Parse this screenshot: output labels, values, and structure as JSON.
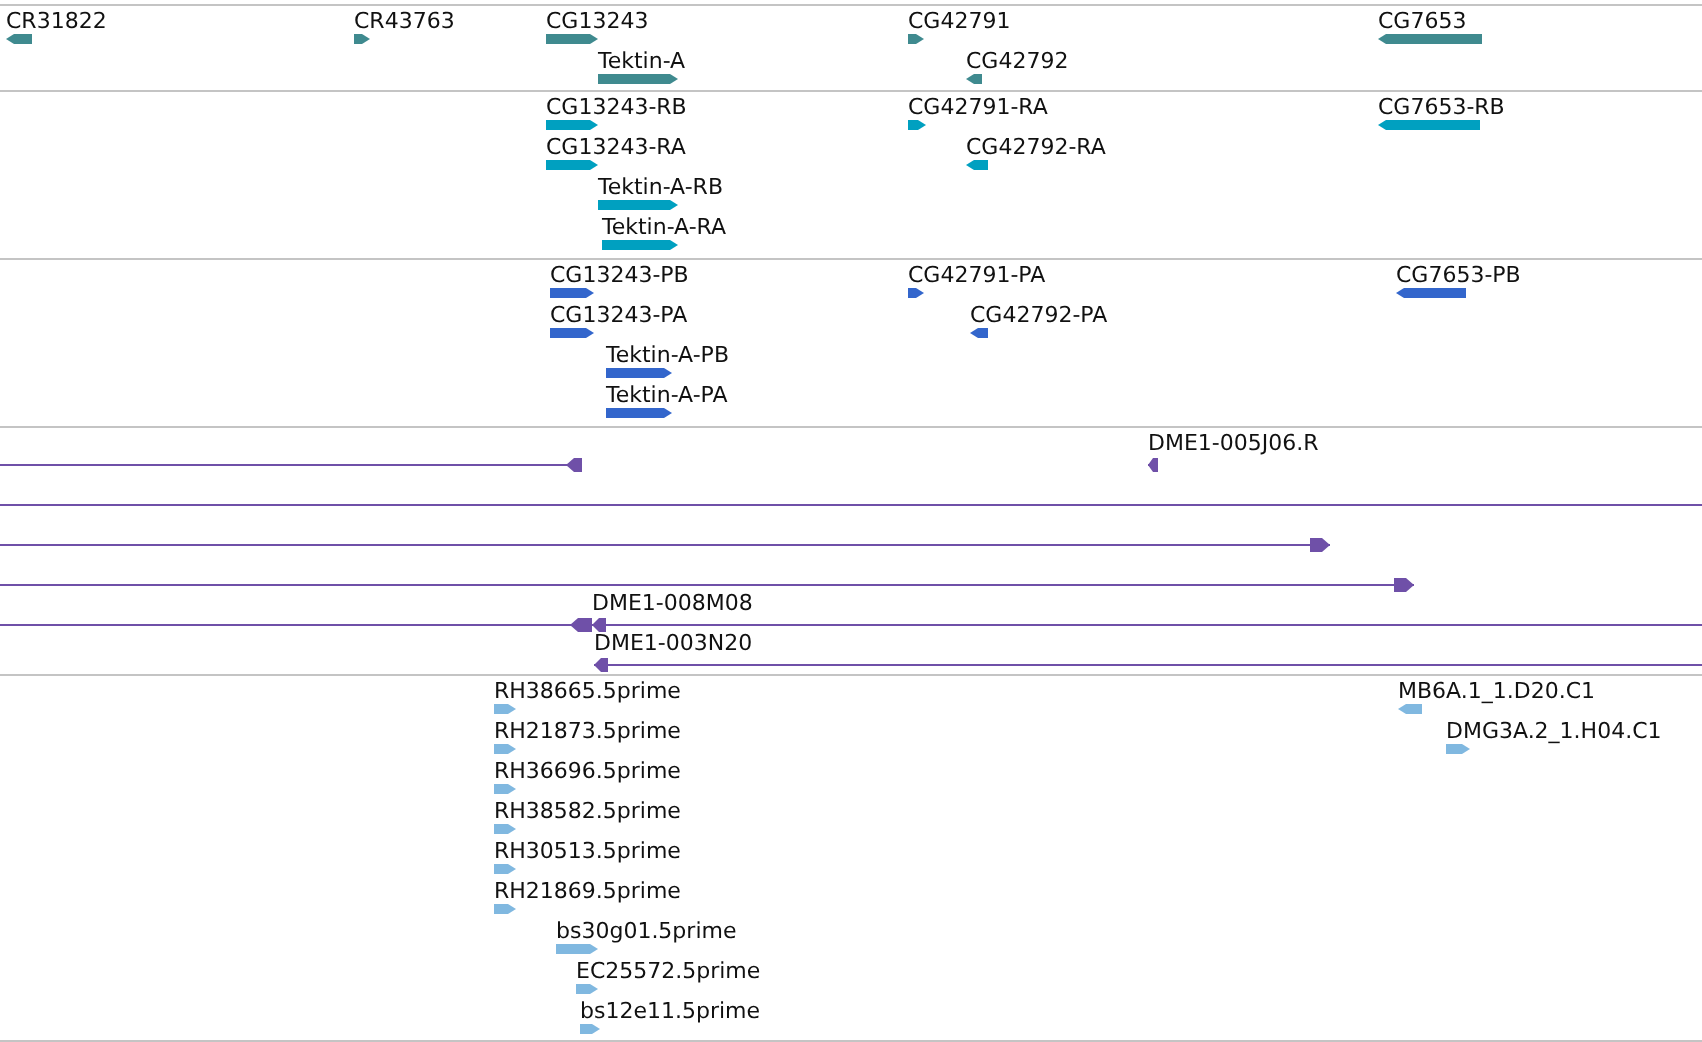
{
  "tracks": [
    {
      "kind": "gene",
      "color": "#3f8a8f",
      "features": [
        {
          "label": "CR31822",
          "reverse": true
        },
        {
          "label": "CR43763",
          "reverse": false
        },
        {
          "label": "CG13243",
          "reverse": false
        },
        {
          "label": "Tektin-A",
          "reverse": false
        },
        {
          "label": "CG42791",
          "reverse": false
        },
        {
          "label": "CG42792",
          "reverse": true
        },
        {
          "label": "CG7653",
          "reverse": true
        }
      ]
    },
    {
      "kind": "gene",
      "color": "#00a0c0",
      "features": [
        {
          "label": "CG13243-RB",
          "reverse": false
        },
        {
          "label": "CG13243-RA",
          "reverse": false
        },
        {
          "label": "Tektin-A-RB",
          "reverse": false
        },
        {
          "label": "Tektin-A-RA",
          "reverse": false
        },
        {
          "label": "CG42791-RA",
          "reverse": false
        },
        {
          "label": "CG42792-RA",
          "reverse": true
        },
        {
          "label": "CG7653-RB",
          "reverse": true
        }
      ]
    },
    {
      "kind": "gene",
      "color": "#3366cc",
      "features": [
        {
          "label": "CG13243-PB",
          "reverse": false
        },
        {
          "label": "CG13243-PA",
          "reverse": false
        },
        {
          "label": "Tektin-A-PB",
          "reverse": false
        },
        {
          "label": "Tektin-A-PA",
          "reverse": false
        },
        {
          "label": "CG42791-PA",
          "reverse": false
        },
        {
          "label": "CG42792-PA",
          "reverse": true
        },
        {
          "label": "CG7653-PB",
          "reverse": true
        }
      ]
    },
    {
      "kind": "read",
      "color": "#6f50a8",
      "features": [
        {
          "kind": "arrow",
          "reverse": true
        },
        {
          "kind": "arrow",
          "label": "DME1-005J06.R",
          "reverse": true
        },
        {
          "kind": "line"
        },
        {
          "kind": "arrow",
          "reverse": false
        },
        {
          "kind": "arrow",
          "reverse": false
        },
        {
          "kind": "arrow",
          "reverse": true
        },
        {
          "kind": "arrow",
          "label": "DME1-008M08",
          "reverse": true
        },
        {
          "kind": "arrow",
          "label": "DME1-003N20",
          "reverse": true
        }
      ]
    },
    {
      "kind": "gene",
      "color": "#80b8e0",
      "features": [
        {
          "label": "RH38665.5prime",
          "reverse": false
        },
        {
          "label": "RH21873.5prime",
          "reverse": false
        },
        {
          "label": "RH36696.5prime",
          "reverse": false
        },
        {
          "label": "RH38582.5prime",
          "reverse": false
        },
        {
          "label": "RH30513.5prime",
          "reverse": false
        },
        {
          "label": "RH21869.5prime",
          "reverse": false
        },
        {
          "label": "bs30g01.5prime",
          "reverse": false
        },
        {
          "label": "EC25572.5prime",
          "reverse": false
        },
        {
          "label": "bs12e11.5prime",
          "reverse": false
        },
        {
          "label": "MB6A.1_1.D20.C1",
          "reverse": true
        },
        {
          "label": "DMG3A.2_1.H04.C1",
          "reverse": false
        }
      ]
    }
  ]
}
